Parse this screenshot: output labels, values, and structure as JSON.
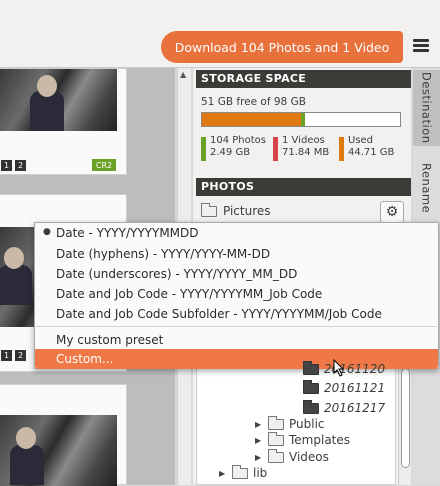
{
  "toolbar": {
    "download_label": "Download 104 Photos and 1 Video",
    "menu_icon": "hamburger-menu-icon"
  },
  "thumbnails": [
    {
      "nums": [
        "1",
        "2"
      ],
      "format": "CR2"
    },
    {
      "nums": [
        "1",
        "2"
      ],
      "format": ""
    },
    {
      "nums": [],
      "format": ""
    }
  ],
  "storage": {
    "header": "STORAGE SPACE",
    "free_text": "51 GB free of 98 GB",
    "legend": [
      {
        "label": "104 Photos",
        "value": "2.49 GB",
        "color": "#6aa226"
      },
      {
        "label": "1 Videos",
        "value": "71.84 MB",
        "color": "#d64545"
      },
      {
        "label": "Used",
        "value": "44.71 GB",
        "color": "#e07a10"
      }
    ]
  },
  "photos": {
    "header": "PHOTOS",
    "folder": "Pictures",
    "gear_icon": "gear-icon"
  },
  "menu": {
    "items": [
      {
        "label": "Date - YYYY/YYYYMMDD",
        "selected": true
      },
      {
        "label": "Date (hyphens) - YYYY/YYYY-MM-DD",
        "selected": false
      },
      {
        "label": "Date (underscores) - YYYY/YYYY_MM_DD",
        "selected": false
      },
      {
        "label": "Date and Job Code - YYYY/YYYYMM_Job Code",
        "selected": false
      },
      {
        "label": "Date and Job Code Subfolder - YYYY/YYYYMM/Job Code",
        "selected": false
      }
    ],
    "custom_preset": "My custom preset",
    "custom": "Custom..."
  },
  "tree": {
    "items": [
      {
        "label": "20161120",
        "indent": 3,
        "italic": true,
        "dark": true,
        "expandable": false
      },
      {
        "label": "20161121",
        "indent": 3,
        "italic": true,
        "dark": true,
        "expandable": false
      },
      {
        "label": "20161217",
        "indent": 3,
        "italic": true,
        "dark": true,
        "expandable": false
      },
      {
        "label": "Public",
        "indent": 2,
        "italic": false,
        "dark": false,
        "expandable": true
      },
      {
        "label": "Templates",
        "indent": 2,
        "italic": false,
        "dark": false,
        "expandable": true
      },
      {
        "label": "Videos",
        "indent": 2,
        "italic": false,
        "dark": false,
        "expandable": true
      },
      {
        "label": "lib",
        "indent": 0,
        "italic": false,
        "dark": false,
        "expandable": true
      }
    ]
  },
  "side_tabs": {
    "destination": "Destination",
    "rename": "Rename"
  }
}
